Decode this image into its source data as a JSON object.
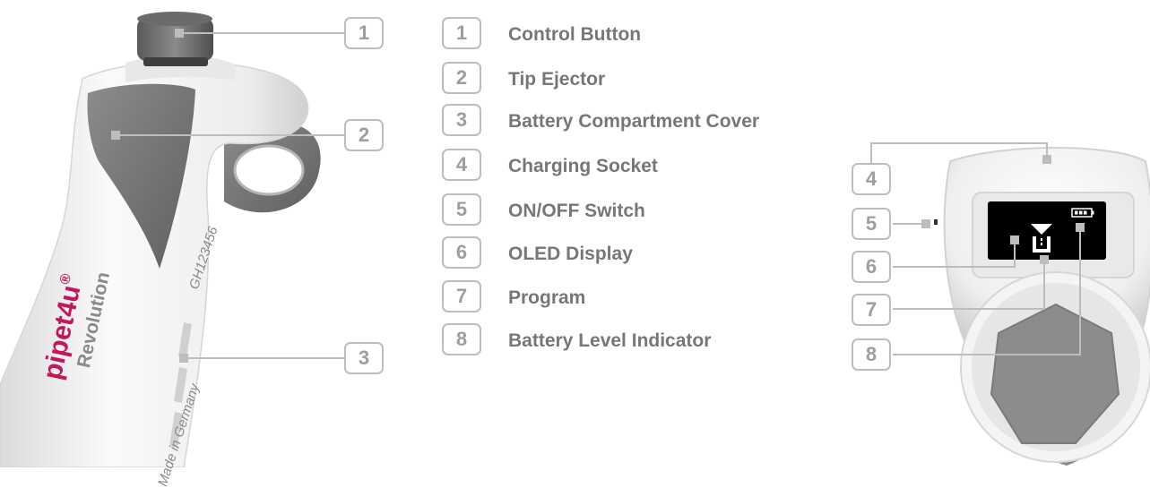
{
  "legend": [
    {
      "number": "1",
      "label": "Control Button"
    },
    {
      "number": "2",
      "label": "Tip Ejector"
    },
    {
      "number": "3",
      "label": "Battery Compartment Cover"
    },
    {
      "number": "4",
      "label": "Charging Socket"
    },
    {
      "number": "5",
      "label": "ON/OFF Switch"
    },
    {
      "number": "6",
      "label": "OLED Display"
    },
    {
      "number": "7",
      "label": "Program"
    },
    {
      "number": "8",
      "label": "Battery Level Indicator"
    }
  ],
  "side_view": {
    "callouts": [
      "1",
      "2",
      "3"
    ],
    "brand_name": "pipet4u",
    "brand_mark": "®",
    "model": "Revolution",
    "serial": "GH123456",
    "made_in": "Made in Germany"
  },
  "top_view": {
    "callouts": [
      "4",
      "5",
      "6",
      "7",
      "8"
    ]
  },
  "colors": {
    "callout_border": "#bdbdbd",
    "callout_text": "#9e9e9e",
    "legend_text": "#777777",
    "brand": "#c2185b",
    "body": "#f2f2f2",
    "grip": "#7d7d7d"
  }
}
